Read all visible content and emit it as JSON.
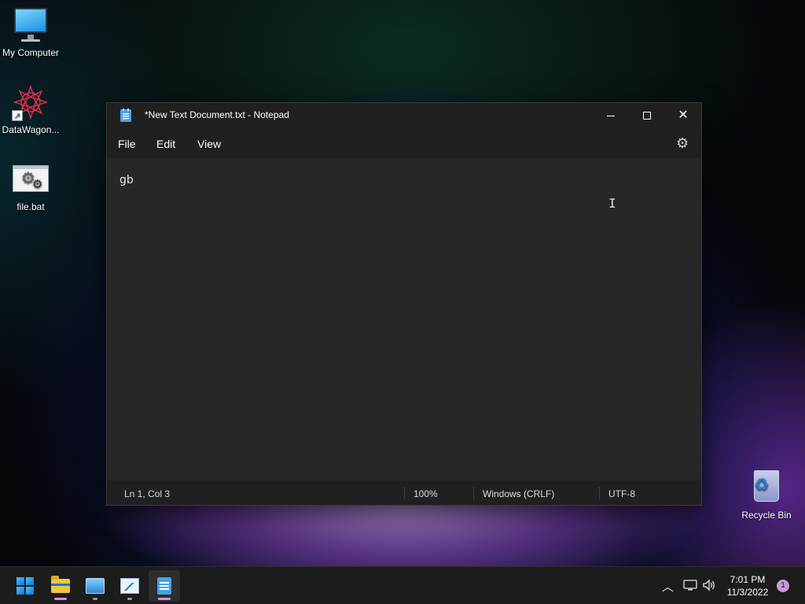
{
  "desktop": {
    "icons": [
      {
        "label": "My Computer"
      },
      {
        "label": "DataWagon..."
      },
      {
        "label": "file.bat"
      },
      {
        "label": "Recycle Bin"
      }
    ]
  },
  "notepad": {
    "title": "*New Text Document.txt - Notepad",
    "menu": {
      "file": "File",
      "edit": "Edit",
      "view": "View"
    },
    "content": "gb",
    "status": {
      "position": "Ln 1, Col 3",
      "zoom": "100%",
      "line_endings": "Windows (CRLF)",
      "encoding": "UTF-8"
    }
  },
  "taskbar": {
    "apps": [
      {
        "name": "start-icon"
      },
      {
        "name": "file-explorer-icon"
      },
      {
        "name": "control-panel-icon"
      },
      {
        "name": "performance-monitor-icon"
      },
      {
        "name": "notepad-icon",
        "active": true
      }
    ],
    "tray": {
      "time": "7:01 PM",
      "date": "11/3/2022",
      "notification_count": "1"
    }
  },
  "colors": {
    "window_bg": "#272727",
    "titlebar_bg": "#202020",
    "taskbar_bg": "#1c1c1c",
    "accent": "#e48bd6"
  }
}
